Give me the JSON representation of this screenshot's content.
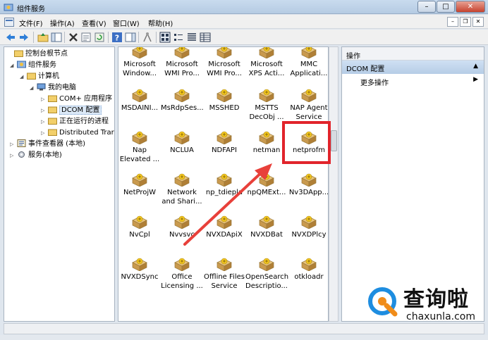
{
  "window": {
    "title": "组件服务"
  },
  "menu": [
    "文件(F)",
    "操作(A)",
    "查看(V)",
    "窗口(W)",
    "帮助(H)"
  ],
  "toolbar_icons": [
    "back-arrow-icon",
    "forward-arrow-icon",
    "up-folder-icon",
    "show-tree-icon",
    "delete-icon",
    "properties-icon",
    "refresh-icon",
    "help-icon",
    "show-action-pane-icon",
    "com-icon",
    "large-icons-view-icon",
    "small-icons-view-icon",
    "list-view-icon",
    "detail-view-icon"
  ],
  "tree": [
    {
      "label": "控制台根节点",
      "icon": "folder-icon",
      "toggle": ""
    },
    {
      "label": "组件服务",
      "icon": "component-services-icon",
      "toggle": "◢"
    },
    {
      "label": "计算机",
      "icon": "folder-icon",
      "toggle": "◢"
    },
    {
      "label": "我的电脑",
      "icon": "computer-icon",
      "toggle": "◢"
    },
    {
      "label": "COM+ 应用程序",
      "icon": "folder-icon",
      "toggle": "▷"
    },
    {
      "label": "DCOM 配置",
      "icon": "folder-icon",
      "toggle": "▷"
    },
    {
      "label": "正在运行的进程",
      "icon": "folder-icon",
      "toggle": "▷"
    },
    {
      "label": "Distributed Trar",
      "icon": "folder-icon",
      "toggle": "▷"
    },
    {
      "label": "事件查看器 (本地)",
      "icon": "event-viewer-icon",
      "toggle": "▷"
    },
    {
      "label": "服务(本地)",
      "icon": "services-icon",
      "toggle": "▷"
    }
  ],
  "items": [
    {
      "l1": "Microsoft",
      "l2": "Window..."
    },
    {
      "l1": "Microsoft",
      "l2": "WMI Pro..."
    },
    {
      "l1": "Microsoft",
      "l2": "WMI Pro..."
    },
    {
      "l1": "Microsoft",
      "l2": "XPS Acti..."
    },
    {
      "l1": "MMC",
      "l2": "Applicati..."
    },
    {
      "l1": "MSDAINI...",
      "l2": ""
    },
    {
      "l1": "MsRdpSes...",
      "l2": ""
    },
    {
      "l1": "MSSHED",
      "l2": ""
    },
    {
      "l1": "MSTTS",
      "l2": "DecObj ..."
    },
    {
      "l1": "NAP Agent",
      "l2": "Service"
    },
    {
      "l1": "Nap",
      "l2": "Elevated ..."
    },
    {
      "l1": "NCLUA",
      "l2": ""
    },
    {
      "l1": "NDFAPI",
      "l2": ""
    },
    {
      "l1": "netman",
      "l2": ""
    },
    {
      "l1": "netprofm",
      "l2": ""
    },
    {
      "l1": "NetProjW",
      "l2": ""
    },
    {
      "l1": "Network",
      "l2": "and Shari..."
    },
    {
      "l1": "np_tdiepla",
      "l2": ""
    },
    {
      "l1": "npQMExt...",
      "l2": ""
    },
    {
      "l1": "Nv3DApp...",
      "l2": ""
    },
    {
      "l1": "NvCpl",
      "l2": ""
    },
    {
      "l1": "Nvvsvc",
      "l2": ""
    },
    {
      "l1": "NVXDApiX",
      "l2": ""
    },
    {
      "l1": "NVXDBat",
      "l2": ""
    },
    {
      "l1": "NVXDPlcy",
      "l2": ""
    },
    {
      "l1": "NVXDSync",
      "l2": ""
    },
    {
      "l1": "Office",
      "l2": "Licensing ..."
    },
    {
      "l1": "Offline Files",
      "l2": "Service"
    },
    {
      "l1": "OpenSearch",
      "l2": "Descriptio..."
    },
    {
      "l1": "otkloadr",
      "l2": ""
    }
  ],
  "actions": {
    "header": "操作",
    "section": "DCOM 配置",
    "more": "更多操作"
  },
  "watermark": {
    "title": "查询啦",
    "sub": "chaxunla.com"
  },
  "colors": {
    "highlight": "#e1242b",
    "arrow": "#e8403a"
  }
}
